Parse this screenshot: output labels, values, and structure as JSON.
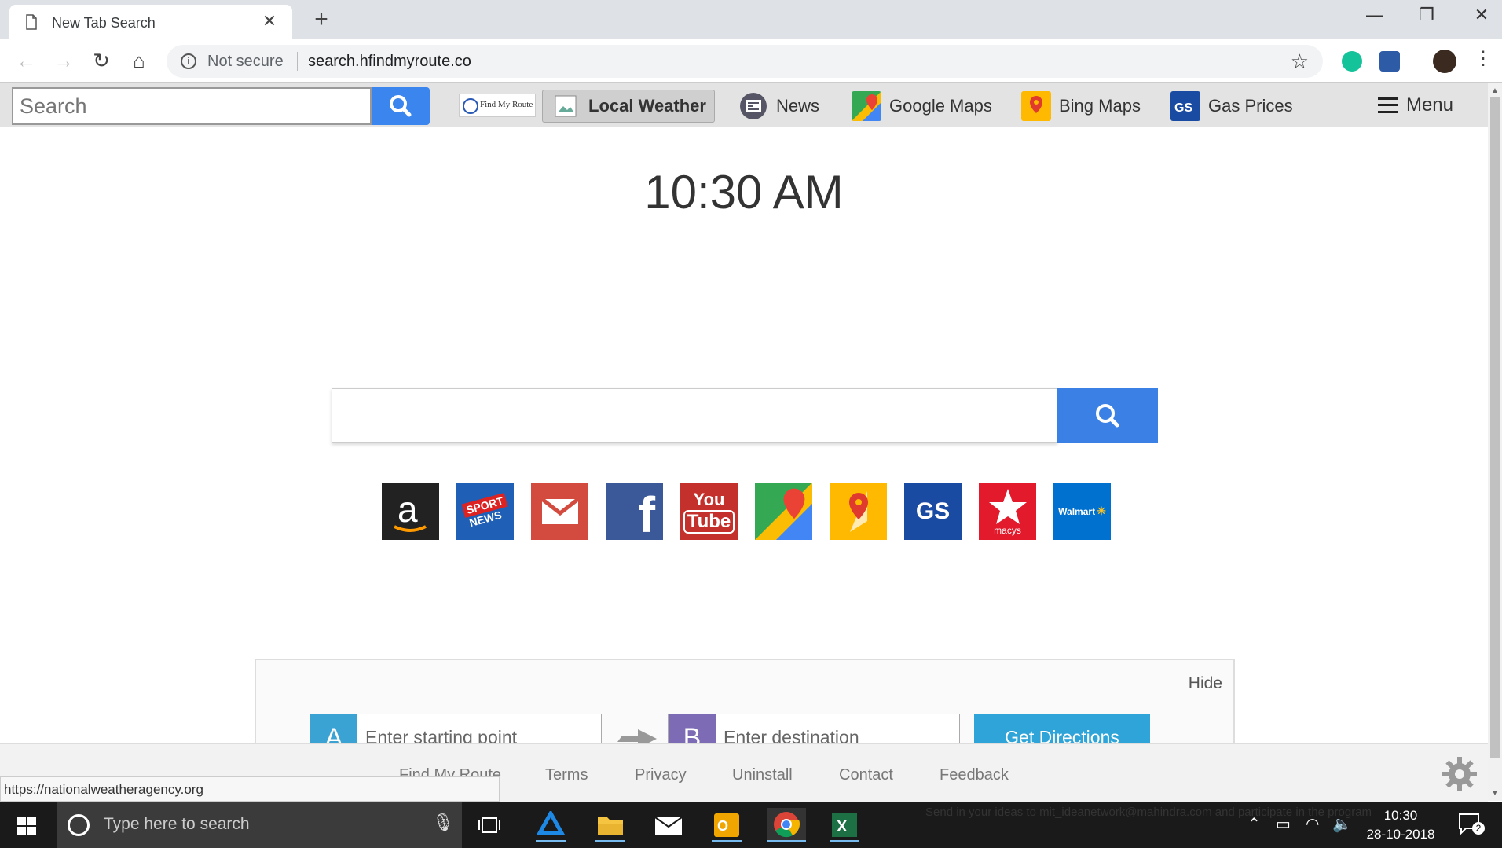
{
  "browser": {
    "tab_title": "New Tab Search",
    "tab_close": "✕",
    "new_tab": "+",
    "win_min": "—",
    "win_restore": "❐",
    "win_close": "✕",
    "back": "←",
    "forward": "→",
    "reload": "↻",
    "home": "⌂",
    "security_label": "Not secure",
    "url": "search.hfindmyroute.co",
    "bookmark_star": "☆"
  },
  "extension_bar": {
    "search_placeholder": "Search",
    "logo_text": "Find My Route",
    "nav_items": [
      {
        "label": "Local Weather",
        "icon": "broken-image-icon",
        "active": true
      },
      {
        "label": "News",
        "icon": "news-icon"
      },
      {
        "label": "Google Maps",
        "icon": "google-maps-icon"
      },
      {
        "label": "Bing Maps",
        "icon": "bing-maps-icon"
      },
      {
        "label": "Gas Prices",
        "icon": "gas-prices-icon"
      }
    ],
    "menu_label": "Menu"
  },
  "main": {
    "clock": "10:30 AM",
    "search_value": "",
    "tiles": [
      {
        "name": "amazon",
        "color": "#222222"
      },
      {
        "name": "sport-news",
        "label1": "SPORT",
        "label2": "NEWS",
        "color": "#1f5fb5"
      },
      {
        "name": "gmail",
        "color": "#d24b3e"
      },
      {
        "name": "facebook",
        "label": "f",
        "color": "#3b5998"
      },
      {
        "name": "youtube",
        "label1": "You",
        "label2": "Tube",
        "color": "#c4302b"
      },
      {
        "name": "google-maps",
        "color": "#34a853"
      },
      {
        "name": "bing-maps",
        "color": "#ffb900"
      },
      {
        "name": "gas-prices",
        "label": "GS",
        "color": "#1a4ba3"
      },
      {
        "name": "macys",
        "label": "macys",
        "color": "#e21a2c"
      },
      {
        "name": "walmart",
        "label": "Walmart",
        "color": "#0071ce"
      }
    ]
  },
  "directions": {
    "hide_label": "Hide",
    "start_badge": "A",
    "start_placeholder": "Enter starting point",
    "dest_badge": "B",
    "dest_placeholder": "Enter destination",
    "button_label": "Get Directions"
  },
  "footer": {
    "links": [
      "Find My Route",
      "Terms",
      "Privacy",
      "Uninstall",
      "Contact",
      "Feedback"
    ],
    "status_url": "https://nationalweatheragency.org"
  },
  "taskbar": {
    "search_placeholder": "Type here to search",
    "faint_text": "Send in your ideas to mit_ideanetwork@mahindra.com and participate in the program",
    "time": "10:30",
    "date": "28-10-2018",
    "notification_count": "2"
  }
}
